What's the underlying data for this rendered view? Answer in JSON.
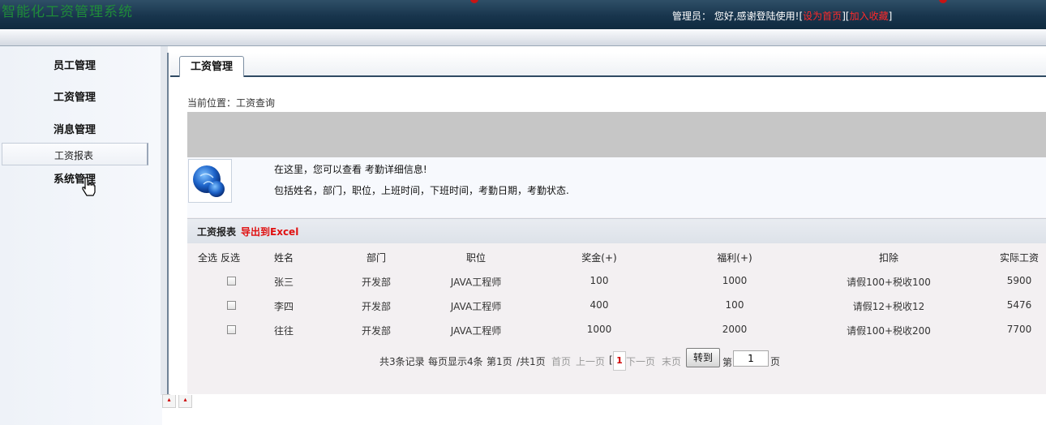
{
  "header": {
    "app_title": "智能化工资管理系统",
    "admin_label": "管理员：",
    "greeting": "您好,感谢登陆使用!",
    "set_home": "设为首页",
    "add_favorite": "加入收藏"
  },
  "sidebar": {
    "items": [
      {
        "label": "员工管理"
      },
      {
        "label": "工资管理"
      },
      {
        "label": "消息管理"
      },
      {
        "label": "系统管理"
      }
    ],
    "sub_item": "工资报表"
  },
  "main": {
    "tab": "工资管理",
    "breadcrumb": "当前位置：工资查询",
    "info_line1": "在这里，您可以查看 考勤详细信息!",
    "info_line2": "包括姓名，部门，职位，上班时间，下班时间，考勤日期，考勤状态."
  },
  "table": {
    "title": "工资报表",
    "export_label": "导出到Excel",
    "select_all": "全选",
    "invert": "反选",
    "columns": [
      "姓名",
      "部门",
      "职位",
      "奖金(+)",
      "福利(+)",
      "扣除",
      "实际工资"
    ],
    "rows": [
      [
        "张三",
        "开发部",
        "JAVA工程师",
        "100",
        "1000",
        "请假100+税收100",
        "5900"
      ],
      [
        "李四",
        "开发部",
        "JAVA工程师",
        "400",
        "100",
        "请假12+税收12",
        "5476"
      ],
      [
        "往往",
        "开发部",
        "JAVA工程师",
        "1000",
        "2000",
        "请假100+税收200",
        "7700"
      ]
    ]
  },
  "pagination": {
    "total": "共3条记录",
    "per_page": "每页显示4条",
    "current": "第1页",
    "pages": "/共1页",
    "first": "首页",
    "prev": "上一页",
    "bracket": "[",
    "page_num": "1",
    "next": "下一页",
    "last": "末页",
    "go": "转到",
    "di": "第",
    "input_value": "1",
    "ye": "页"
  },
  "colors": {
    "header_bg": "#18354d",
    "title_green": "#1f8a3a",
    "link_red": "#ff2a2a",
    "export_red": "#e01010"
  },
  "icons": [
    "pointer-cursor-icon",
    "globe-info-icon"
  ]
}
